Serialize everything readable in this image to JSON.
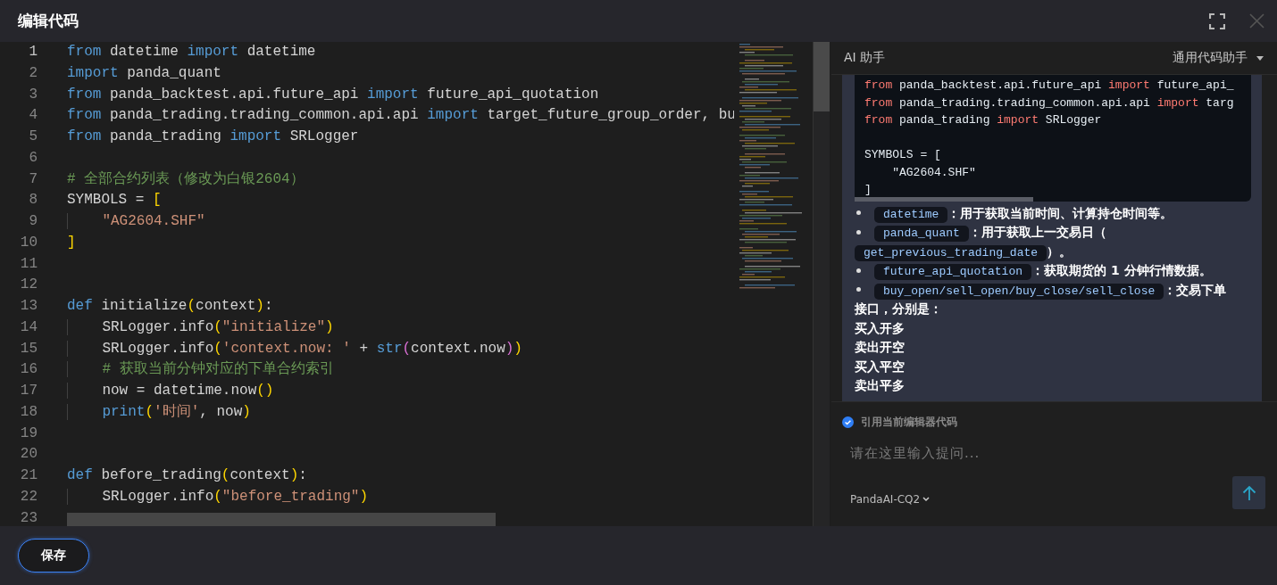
{
  "window": {
    "title": "编辑代码"
  },
  "editor": {
    "lines": [
      {
        "number": "1",
        "tokens": [
          {
            "kind": "kw",
            "text": "from"
          },
          {
            "kind": "pl",
            "text": " datetime "
          },
          {
            "kind": "kw",
            "text": "import"
          },
          {
            "kind": "pl",
            "text": " datetime"
          }
        ]
      },
      {
        "number": "2",
        "tokens": [
          {
            "kind": "kw",
            "text": "import"
          },
          {
            "kind": "pl",
            "text": " panda_quant"
          }
        ]
      },
      {
        "number": "3",
        "tokens": [
          {
            "kind": "kw",
            "text": "from"
          },
          {
            "kind": "pl",
            "text": " panda_backtest.api.future_api "
          },
          {
            "kind": "kw",
            "text": "import"
          },
          {
            "kind": "pl",
            "text": " future_api_quotation"
          }
        ]
      },
      {
        "number": "4",
        "tokens": [
          {
            "kind": "kw",
            "text": "from"
          },
          {
            "kind": "pl",
            "text": " panda_trading.trading_common.api.api "
          },
          {
            "kind": "kw",
            "text": "import"
          },
          {
            "kind": "pl",
            "text": " target_future_group_order, bu"
          }
        ]
      },
      {
        "number": "5",
        "tokens": [
          {
            "kind": "kw",
            "text": "from"
          },
          {
            "kind": "pl",
            "text": " panda_trading "
          },
          {
            "kind": "kw",
            "text": "import"
          },
          {
            "kind": "pl",
            "text": " SRLogger"
          }
        ]
      },
      {
        "number": "6"
      },
      {
        "number": "7",
        "tokens": [
          {
            "kind": "com",
            "text": "# 全部合约列表（修改为白银2604）"
          }
        ]
      },
      {
        "number": "8",
        "tokens": [
          {
            "kind": "pl",
            "text": "SYMBOLS = "
          },
          {
            "kind": "b1",
            "text": "["
          }
        ]
      },
      {
        "number": "9",
        "tokens": [
          {
            "kind": "str",
            "text": "    \"AG2604.SHF\""
          }
        ]
      },
      {
        "number": "10",
        "tokens": [
          {
            "kind": "b1",
            "text": "]"
          }
        ]
      },
      {
        "number": "11"
      },
      {
        "number": "12"
      },
      {
        "number": "13",
        "tokens": [
          {
            "kind": "kw",
            "text": "def"
          },
          {
            "kind": "pl",
            "text": " initialize"
          },
          {
            "kind": "b1",
            "text": "("
          },
          {
            "kind": "pl",
            "text": "context"
          },
          {
            "kind": "b1",
            "text": ")"
          },
          {
            "kind": "pl",
            "text": ":"
          }
        ]
      },
      {
        "number": "14",
        "tokens": [
          {
            "kind": "pl",
            "text": "    SRLogger.info"
          },
          {
            "kind": "b1",
            "text": "("
          },
          {
            "kind": "str",
            "text": "\"initialize\""
          },
          {
            "kind": "b1",
            "text": ")"
          }
        ]
      },
      {
        "number": "15",
        "tokens": [
          {
            "kind": "pl",
            "text": "    SRLogger.info"
          },
          {
            "kind": "b1",
            "text": "("
          },
          {
            "kind": "str",
            "text": "'context.now: '"
          },
          {
            "kind": "pl",
            "text": " + "
          },
          {
            "kind": "kw",
            "text": "str"
          },
          {
            "kind": "b2",
            "text": "("
          },
          {
            "kind": "pl",
            "text": "context.now"
          },
          {
            "kind": "b2",
            "text": ")"
          },
          {
            "kind": "b1",
            "text": ")"
          }
        ]
      },
      {
        "number": "16",
        "tokens": [
          {
            "kind": "com",
            "text": "    # 获取当前分钟对应的下单合约索引"
          }
        ]
      },
      {
        "number": "17",
        "tokens": [
          {
            "kind": "pl",
            "text": "    now = datetime.now"
          },
          {
            "kind": "b1",
            "text": "()"
          }
        ]
      },
      {
        "number": "18",
        "tokens": [
          {
            "kind": "kw",
            "text": "    print"
          },
          {
            "kind": "b1",
            "text": "("
          },
          {
            "kind": "str",
            "text": "'时间'"
          },
          {
            "kind": "pl",
            "text": ", now"
          },
          {
            "kind": "b1",
            "text": ")"
          }
        ]
      },
      {
        "number": "19"
      },
      {
        "number": "20"
      },
      {
        "number": "21",
        "tokens": [
          {
            "kind": "kw",
            "text": "def"
          },
          {
            "kind": "pl",
            "text": " before_trading"
          },
          {
            "kind": "b1",
            "text": "("
          },
          {
            "kind": "pl",
            "text": "context"
          },
          {
            "kind": "b1",
            "text": ")"
          },
          {
            "kind": "pl",
            "text": ":"
          }
        ]
      },
      {
        "number": "22",
        "tokens": [
          {
            "kind": "pl",
            "text": "    SRLogger.info"
          },
          {
            "kind": "b1",
            "text": "("
          },
          {
            "kind": "str",
            "text": "\"before_trading\""
          },
          {
            "kind": "b1",
            "text": ")"
          }
        ]
      },
      {
        "number": "23"
      }
    ]
  },
  "ai_panel": {
    "title": "AI 助手",
    "assistant_selector": "通用代码助手",
    "code_block": [
      {
        "kind": "code",
        "tokens": [
          {
            "kind": "kw",
            "text": "from"
          },
          {
            "kind": "pl",
            "text": " panda_backtest.api.future_api "
          },
          {
            "kind": "kw",
            "text": "import"
          },
          {
            "kind": "pl",
            "text": " future_api_"
          }
        ]
      },
      {
        "kind": "code",
        "tokens": [
          {
            "kind": "kw",
            "text": "from"
          },
          {
            "kind": "pl",
            "text": " panda_trading.trading_common.api.api "
          },
          {
            "kind": "kw",
            "text": "import"
          },
          {
            "kind": "pl",
            "text": " targ"
          }
        ]
      },
      {
        "kind": "code",
        "tokens": [
          {
            "kind": "kw",
            "text": "from"
          },
          {
            "kind": "pl",
            "text": " panda_trading "
          },
          {
            "kind": "kw",
            "text": "import"
          },
          {
            "kind": "pl",
            "text": " SRLogger"
          }
        ]
      },
      {
        "kind": "blank"
      },
      {
        "kind": "code",
        "tokens": [
          {
            "kind": "pl",
            "text": "SYMBOLS = ["
          }
        ]
      },
      {
        "kind": "code",
        "tokens": [
          {
            "kind": "pl",
            "text": "    \"AG2604.SHF\""
          }
        ]
      },
      {
        "kind": "code",
        "tokens": [
          {
            "kind": "pl",
            "text": "]"
          }
        ]
      }
    ],
    "bullets": [
      [
        {
          "kind": "code",
          "text": "datetime"
        },
        {
          "kind": "text",
          "text": "：用于获取当前时间、计算持仓时间等。"
        }
      ],
      [
        {
          "kind": "code",
          "text": "panda_quant"
        },
        {
          "kind": "text",
          "text": "：用于获取上一交易日（"
        },
        {
          "kind": "code",
          "text": "get_previous_trading_date"
        },
        {
          "kind": "text",
          "text": "）。"
        }
      ],
      [
        {
          "kind": "code",
          "text": "future_api_quotation"
        },
        {
          "kind": "text",
          "text": "：获取期货的 1 分钟行情数据。"
        }
      ],
      [
        {
          "kind": "code",
          "text": "buy_open/sell_open/buy_close/sell_close"
        },
        {
          "kind": "text",
          "text": "：交易下单"
        }
      ]
    ],
    "paragraphs": [
      "接口，分别是：",
      "买入开多",
      "卖出开空",
      "买入平空",
      "卖出平多"
    ]
  },
  "input": {
    "reference_code": {
      "label": "引用当前编辑器代码",
      "checked": true
    },
    "placeholder": "请在这里输入提问...",
    "model": "PandaAI-CQ2"
  },
  "footer": {
    "save_button": "保存"
  }
}
